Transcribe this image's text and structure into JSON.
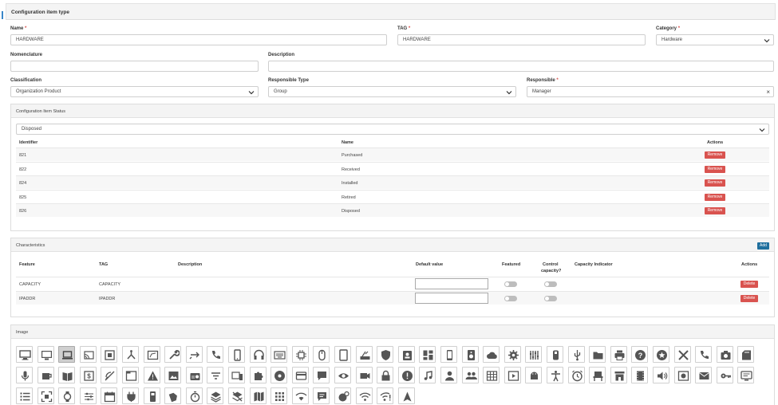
{
  "header": {
    "title": "Configuration item type"
  },
  "form": {
    "name_label": "Name",
    "name_value": "HARDWARE",
    "tag_label": "TAG",
    "tag_value": "HARDWARE",
    "category_label": "Category",
    "category_value": "Hardware",
    "nomenclature_label": "Nomenclature",
    "nomenclature_value": "",
    "description_label": "Description",
    "description_value": "",
    "classification_label": "Classification",
    "classification_value": "Organization Product",
    "responsible_type_label": "Responsible Type",
    "responsible_type_value": "Group",
    "responsible_label": "Responsible",
    "responsible_value": "Manager",
    "required_mark": "*"
  },
  "status_panel": {
    "title": "Configuration Item Status",
    "select_value": "Disposed",
    "columns": {
      "identifier": "Identifier",
      "name": "Name",
      "actions": "Actions"
    },
    "remove_label": "Remove",
    "rows": [
      {
        "id": "821",
        "name": "Purchased"
      },
      {
        "id": "822",
        "name": "Received"
      },
      {
        "id": "824",
        "name": "Installed"
      },
      {
        "id": "825",
        "name": "Retired"
      },
      {
        "id": "826",
        "name": "Disposed"
      }
    ]
  },
  "characteristics": {
    "title": "Characteristics",
    "add_label": "Add",
    "columns": {
      "feature": "Feature",
      "tag": "TAG",
      "description": "Description",
      "default_value": "Default value",
      "featured": "Featured",
      "control_capacity_1": "Control",
      "control_capacity_2": "capacity?",
      "capacity_indicator": "Capacity Indicator",
      "actions": "Actions"
    },
    "delete_label": "Delete",
    "rows": [
      {
        "feature": "CAPACITY",
        "tag": "CAPACITY",
        "description": "",
        "default_value": ""
      },
      {
        "feature": "IPADDR",
        "tag": "IPADDR",
        "description": "",
        "default_value": ""
      }
    ]
  },
  "image_panel": {
    "title": "Image",
    "selected_icon": "laptop-icon",
    "icons": [
      "desktop-icon",
      "monitor-icon",
      "laptop-icon",
      "cast-icon",
      "memory-icon",
      "fork-icon",
      "screen-icon",
      "wrench-icon",
      "swap-icon",
      "phone-forward-icon",
      "smartphone-icon",
      "headset-icon",
      "keyboard-icon",
      "chip-icon",
      "mouse-icon",
      "tablet-icon",
      "router-icon",
      "shield-icon",
      "badge-icon",
      "dashboard-icon",
      "phone-android-icon",
      "speaker-icon",
      "cloud-icon",
      "gear-icon",
      "equalizer-icon",
      "case-icon",
      "usb-icon",
      "folder-icon",
      "printer-icon",
      "help-icon",
      "star-circle-icon",
      "tools-icon",
      "phone-icon",
      "camera-icon",
      "sd-card-icon",
      "mic-icon",
      "cup-icon",
      "book-icon",
      "money-icon",
      "no-signal-icon",
      "window-icon",
      "warning-icon",
      "image-icon",
      "radio-icon",
      "filter-icon",
      "devices-icon",
      "puzzle-icon",
      "disc-icon",
      "card-icon",
      "chat-icon",
      "eye-icon",
      "video-icon",
      "lock-icon",
      "alert-icon",
      "music-icon",
      "person-icon",
      "group-icon",
      "grid-icon",
      "slideshow-icon",
      "android-icon",
      "accessibility-icon",
      "alarm-icon",
      "chair-icon",
      "store-icon",
      "film-icon",
      "volume-icon",
      "photo-camera-icon",
      "mail-icon",
      "key-icon",
      "display-icon",
      "list-icon",
      "fit-screen-icon",
      "watch-icon",
      "sliders-icon",
      "calendar-icon",
      "plug-icon",
      "remote-icon",
      "labels-icon",
      "timer-icon",
      "layers-icon",
      "layers-off-icon",
      "map-icon",
      "apps-icon",
      "wifi-low-icon",
      "comment-icon",
      "globe-pin-icon",
      "wifi-icon",
      "wifi-alert-icon",
      "navigation-icon",
      "contrast-icon"
    ]
  }
}
